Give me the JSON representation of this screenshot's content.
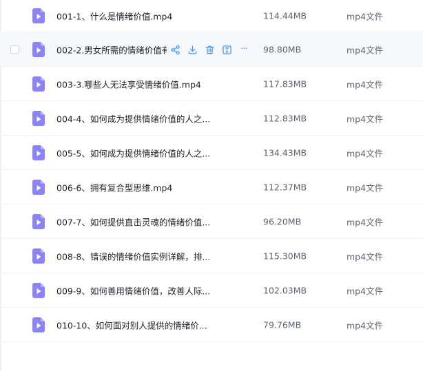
{
  "colors": {
    "accent": "#3c9cff",
    "file_icon": "#8c83f5",
    "hover_row": "#f7f8fc"
  },
  "icons": {
    "file": "video-file-icon",
    "actions": [
      "share-icon",
      "download-icon",
      "delete-icon",
      "rename-icon",
      "more-icon"
    ]
  },
  "files": [
    {
      "name": "001-1、什么是情绪价值.mp4",
      "size": "114.44MB",
      "type": "mp4文件"
    },
    {
      "name": "002-2.男女所需的情绪价值有",
      "size": "98.80MB",
      "type": "mp4文件",
      "more": "···"
    },
    {
      "name": "003-3.哪些人无法享受情绪价值.mp4",
      "size": "117.83MB",
      "type": "mp4文件"
    },
    {
      "name": "004-4、如何成为提供情绪价值的人之...",
      "size": "112.83MB",
      "type": "mp4文件"
    },
    {
      "name": "005-5、如何成为提供情绪价值的人之...",
      "size": "134.43MB",
      "type": "mp4文件"
    },
    {
      "name": "006-6、拥有复合型思维.mp4",
      "size": "112.37MB",
      "type": "mp4文件"
    },
    {
      "name": "007-7、如何提供直击灵魂的情绪价值...",
      "size": "96.20MB",
      "type": "mp4文件"
    },
    {
      "name": "008-8、错误的情绪价值实例详解，排...",
      "size": "115.30MB",
      "type": "mp4文件"
    },
    {
      "name": "009-9、如何善用情绪价值，改善人际...",
      "size": "102.03MB",
      "type": "mp4文件"
    },
    {
      "name": "010-10、如何面对别人提供的情绪价...",
      "size": "79.76MB",
      "type": "mp4文件"
    }
  ]
}
